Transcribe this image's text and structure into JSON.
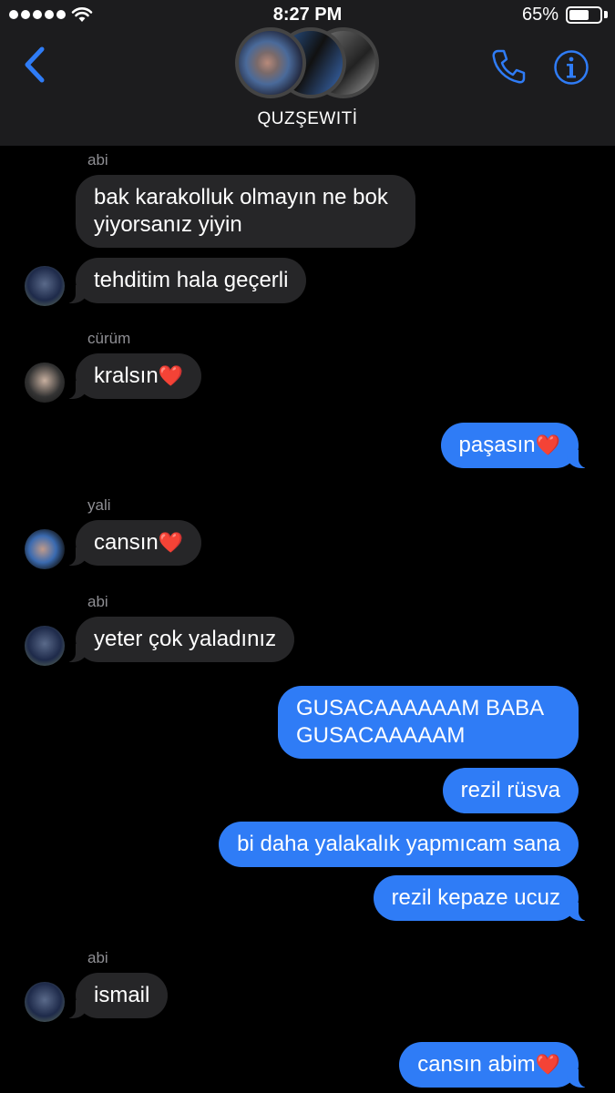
{
  "status_bar": {
    "time": "8:27 PM",
    "battery_percent": "65%",
    "battery_level": 0.65,
    "signal_bars": 5
  },
  "header": {
    "group_name": "QUZŞEWITİ",
    "back_icon": "chevron-left-icon",
    "call_icon": "phone-icon",
    "info_icon": "info-icon",
    "accent_color": "#2f7cf6"
  },
  "messages": [
    {
      "sender": "abi",
      "text": "bak karakolluk olmayın ne bok\nyiyorsanız yiyin",
      "direction": "in"
    },
    {
      "sender": "",
      "text": "tehditim hala geçerli",
      "direction": "in"
    },
    {
      "sender": "cürüm",
      "text": "kralsın",
      "heart": "❤️",
      "direction": "in"
    },
    {
      "sender": "",
      "text": "paşasın",
      "heart": "❤️",
      "direction": "out"
    },
    {
      "sender": "yali",
      "text": "cansın",
      "heart": "❤️",
      "direction": "in"
    },
    {
      "sender": "abi",
      "text": "yeter çok yaladınız",
      "direction": "in"
    },
    {
      "sender": "",
      "text": "GUSACAAAAAAM BABA\nGUSACAAAAAM",
      "direction": "out"
    },
    {
      "sender": "",
      "text": "rezil rüsva",
      "direction": "out"
    },
    {
      "sender": "",
      "text": "bi daha yalakalık yapmıcam sana",
      "direction": "out"
    },
    {
      "sender": "",
      "text": "rezil kepaze ucuz",
      "direction": "out"
    },
    {
      "sender": "abi",
      "text": "ismail",
      "direction": "in"
    },
    {
      "sender": "",
      "text": "cansın abim",
      "heart": "❤️",
      "direction": "out"
    }
  ]
}
